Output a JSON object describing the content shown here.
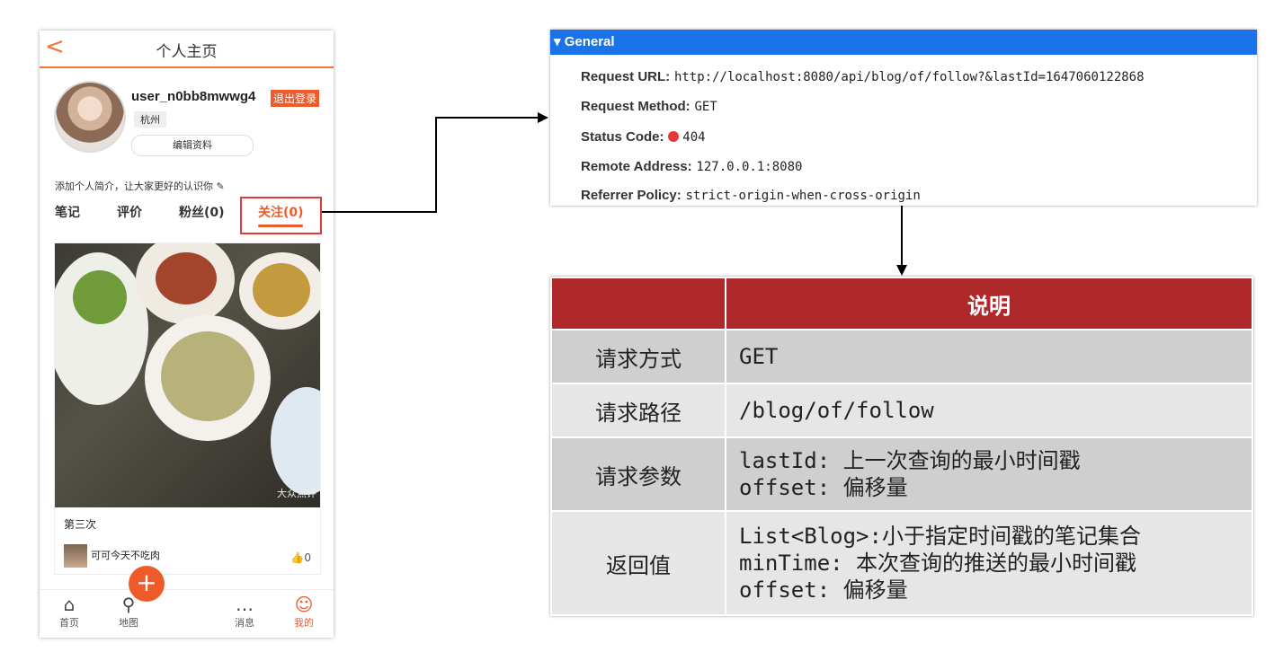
{
  "phone": {
    "back_glyph": "<",
    "title": "个人主页",
    "username": "user_n0bb8mwwg4",
    "logout": "退出登录",
    "city": "杭州",
    "edit_profile": "编辑资料",
    "bio": "添加个人简介，让大家更好的认识你 ✎",
    "tabs": [
      {
        "label": "笔记"
      },
      {
        "label": "评价"
      },
      {
        "label": "粉丝(0)"
      },
      {
        "label": "关注(0)"
      }
    ],
    "note": {
      "title": "第三次",
      "author": "可可今天不吃肉",
      "likes_icon": "👍",
      "likes": "0",
      "watermark": "大众点评"
    },
    "nav": [
      {
        "label": "首页",
        "icon": "home-icon",
        "glyph": "⌂"
      },
      {
        "label": "地图",
        "icon": "map-pin-icon",
        "glyph": "⚲"
      },
      {
        "label": "",
        "icon": "plus-icon",
        "glyph": "+"
      },
      {
        "label": "消息",
        "icon": "message-icon",
        "glyph": "…"
      },
      {
        "label": "我的",
        "icon": "user-icon",
        "glyph": "☺"
      }
    ],
    "accent_color": "#ee5b2a"
  },
  "network": {
    "header": "▾ General",
    "rows": [
      {
        "key": "Request URL:",
        "value": "http://localhost:8080/api/blog/of/follow?&lastId=1647060122868"
      },
      {
        "key": "Request Method:",
        "value": "GET"
      },
      {
        "key": "Status Code:",
        "value": "404"
      },
      {
        "key": "Remote Address:",
        "value": "127.0.0.1:8080"
      },
      {
        "key": "Referrer Policy:",
        "value": "strict-origin-when-cross-origin"
      }
    ],
    "header_color": "#1a73e8"
  },
  "table": {
    "header": "说明",
    "rows": [
      {
        "label": "请求方式",
        "lines": [
          "GET"
        ]
      },
      {
        "label": "请求路径",
        "lines": [
          "/blog/of/follow"
        ]
      },
      {
        "label": "请求参数",
        "lines": [
          "lastId: 上一次查询的最小时间戳",
          "offset: 偏移量"
        ]
      },
      {
        "label": "返回值",
        "lines": [
          "List<Blog>:小于指定时间戳的笔记集合",
          "minTime: 本次查询的推送的最小时间戳",
          "offset: 偏移量"
        ]
      }
    ],
    "header_color": "#b0292a"
  }
}
